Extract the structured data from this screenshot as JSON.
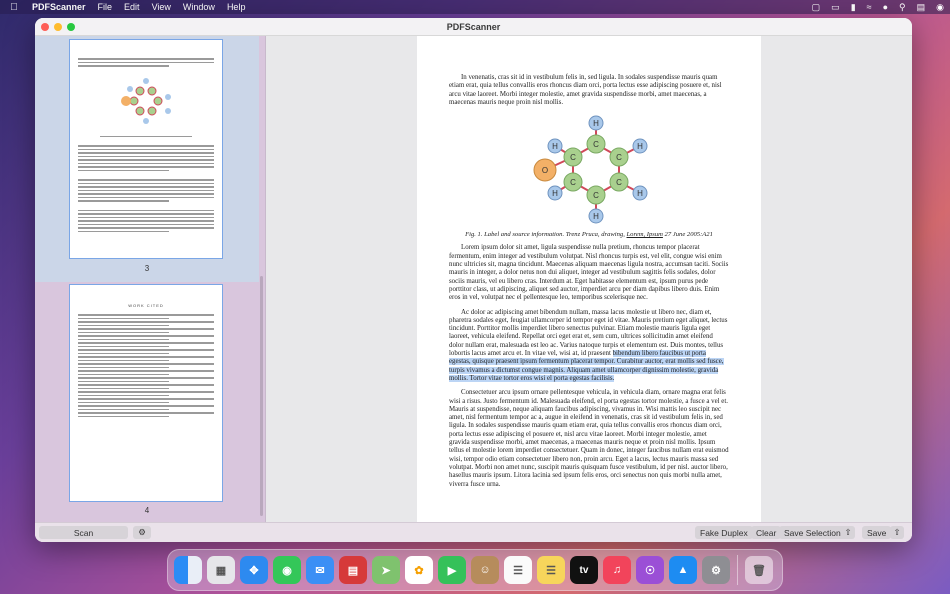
{
  "menubar": {
    "app_name": "PDFScanner",
    "items": [
      "File",
      "Edit",
      "View",
      "Window",
      "Help"
    ]
  },
  "window": {
    "title": "PDFScanner"
  },
  "sidebar": {
    "pages": [
      {
        "label": "3"
      },
      {
        "label": "4"
      }
    ],
    "thumb4_title": "WORK CITED"
  },
  "document": {
    "para1": "In venenatis, cras sit id in vestibulum felis in, sed ligula. In sodales suspendisse mauris quam etiam erat, quia tellus convallis eros rhoncus diam orci, porta lectus esse adipiscing posuere et, nisl arcu vitae laoreet. Morbi integer molestie, amet gravida suspendisse morbi, amet maecenas, a maecenas mauris neque proin nisl mollis.",
    "molecule_atoms": {
      "H": "H",
      "C": "C",
      "O": "O"
    },
    "caption_pre": "Fig. 1. Label and source information. Trenz Pruca, drawing, ",
    "caption_link": "Lorem, Ipsum",
    "caption_post": " 27 June 2005:A21",
    "para2": "Lorem ipsum dolor sit amet, ligula suspendisse nulla pretium, rhoncus tempor placerat fermentum, enim integer ad vestibulum volutpat. Nisl rhoncus turpis est, vel elit, congue wisi enim nunc ultricies sit, magna tincidunt. Maecenas aliquam maecenas ligula nostra, accumsan taciti. Sociis mauris in integer, a dolor netus non dui aliquet, integer ad vestibulum sagittis felis sodales, dolor sociis mauris, vel eu libero cras. Interdum at. Eget habitasse elementum est, ipsum purus pede porttitor class, ut adipiscing, aliquet sed auctor, imperdiet arcu per diam dapibus libero duis. Enim eros in vel, volutpat nec el pellentesque leo, temporibus scelerisque nec.",
    "para3_pre": "Ac dolor ac adipiscing amet bibendum nullam, massa lacus molestie ut libero nec, diam et, pharetra sodales eget, feugiat ullamcorper id tempor eget id vitae. Mauris pretium eget aliquet, lectus tincidunt. Porttitor mollis imperdiet libero senectus pulvinar. Etiam molestie mauris ligula eget laoreet, vehicula eleifend. Repellat orci eget erat et, sem cum, ultrices sollicitudin amet eleifend dolor nullam erat, malesuada est leo ac. Varius natoque turpis et elementum est. Duis montes, tellus lobortis lacus amet arcu et. In vitae vel, wisi at, id praesent ",
    "para3_highlight": "bibendum libero faucibus ut porta egestas, quisque praesent ipsum fermentum placerat tempor. Curabitur auctor, erat mollis sed fusce, turpis vivamus a dictumst congue magnis. Aliquam amet ullamcorper dignissim molestie, gravida mollis. Tortor vitae tortor eros wisi el porta egestas facilisis.",
    "para4": "Consectetuer arcu ipsum ornare pellentesque vehicula, in vehicula diam, ornare magna erat felis wisi a risus. Justo fermentum id. Malesuada eleifend, el porta egestas tortor molestie, a fusce a vel et. Mauris at suspendisse, neque aliquam faucibus adipiscing, vivamus in. Wisi mattis leo suscipit nec amet, nisl fermentum tempor ac a, augue in eleifend in venenatis, cras sit id vestibulum felis in, sed ligula. In sodales suspendisse mauris quam etiam erat, quia tellus convallis eros rhoncus diam orci, porta lectus esse adipiscing el posuere et, nisl arcu vitae laoreet. Morbi integer molestie, amet gravida suspendisse morbi, amet maecenas, a maecenas mauris neque et proin nisl mollis. Ipsum tellus el molestie lorem imperdiet consectetuer. Quam in donec, integer faucibus nullam erat euismod wisi, tempor odio etiam consectetuer libero non, proin arcu. Eget a lacus, lectus mauris massa sed volutpat. Morbi non amet nunc, suscipit mauris quisquam fusce vestibulum, id per nisl. auctor libero, hasellus mauris ipsum. Litora lacinia sed ipsum felis eros, orci senectus non quis morbi nulla amet, viverra fusce urna."
  },
  "bottombar": {
    "scan_label": "Scan",
    "fake_duplex_label": "Fake Duplex",
    "clear_label": "Clear",
    "save_selection_label": "Save Selection",
    "save_label": "Save"
  },
  "dock": {
    "apps": [
      "finder-icon",
      "launchpad-icon",
      "safari-icon",
      "messages-icon",
      "mail-icon",
      "pdfscanner-icon",
      "maps-icon",
      "photos-icon",
      "facetime-icon",
      "contacts-icon",
      "reminders-icon",
      "notes-icon",
      "appletv-icon",
      "music-icon",
      "podcasts-icon",
      "appstore-icon",
      "settings-icon",
      "trash-icon"
    ],
    "appletv_label": "tv"
  },
  "colors": {
    "accent": "#7aa6e6",
    "highlight": "#bcd5f5",
    "atom_carbon": "#a9d08e",
    "atom_hydrogen": "#a9c8ea",
    "atom_oxygen": "#f3b067",
    "bond": "#d0495a"
  }
}
